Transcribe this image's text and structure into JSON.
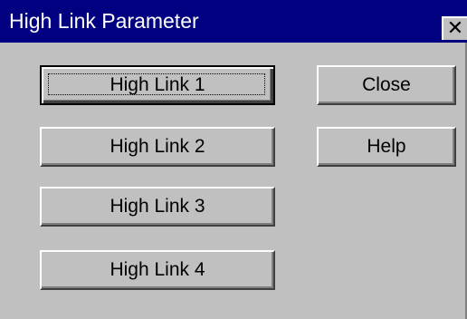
{
  "window": {
    "title": "High Link Parameter",
    "close_glyph": "✕"
  },
  "buttons": {
    "high_link_1": "High Link 1",
    "high_link_2": "High Link 2",
    "high_link_3": "High Link 3",
    "high_link_4": "High Link 4",
    "close": "Close",
    "help": "Help"
  },
  "colors": {
    "titlebar": "#000080",
    "face": "#c0c0c0"
  },
  "icons": {
    "close": "close-icon"
  }
}
